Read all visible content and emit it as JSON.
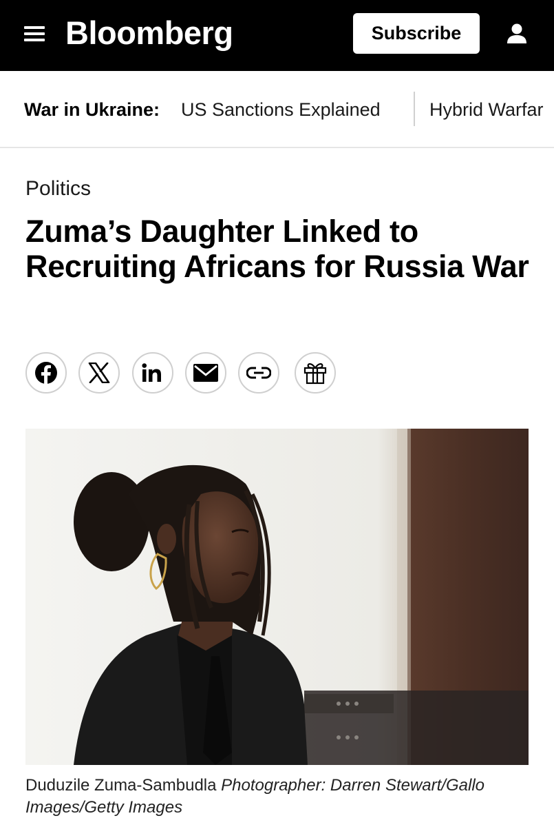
{
  "header": {
    "logo_text": "Bloomberg",
    "subscribe_label": "Subscribe",
    "menu_icon": "hamburger-menu-icon",
    "user_icon": "user-icon"
  },
  "subnav": {
    "label": "War in Ukraine:",
    "links": [
      "US Sanctions Explained",
      "Hybrid Warfar"
    ]
  },
  "article": {
    "category": "Politics",
    "headline": "Zuma’s Daughter Linked to Recruiting Africans for Russia War",
    "share_icons": [
      "facebook-icon",
      "x-icon",
      "linkedin-icon",
      "email-icon",
      "link-icon",
      "gift-icon"
    ],
    "photo_caption": "Duduzile Zuma-Sambudla",
    "photo_credit": "Photographer: Darren Stewart/Gallo Images/Getty Images"
  },
  "colors": {
    "header_bg": "#000000",
    "text": "#000000",
    "share_border": "#cfcfcf"
  }
}
